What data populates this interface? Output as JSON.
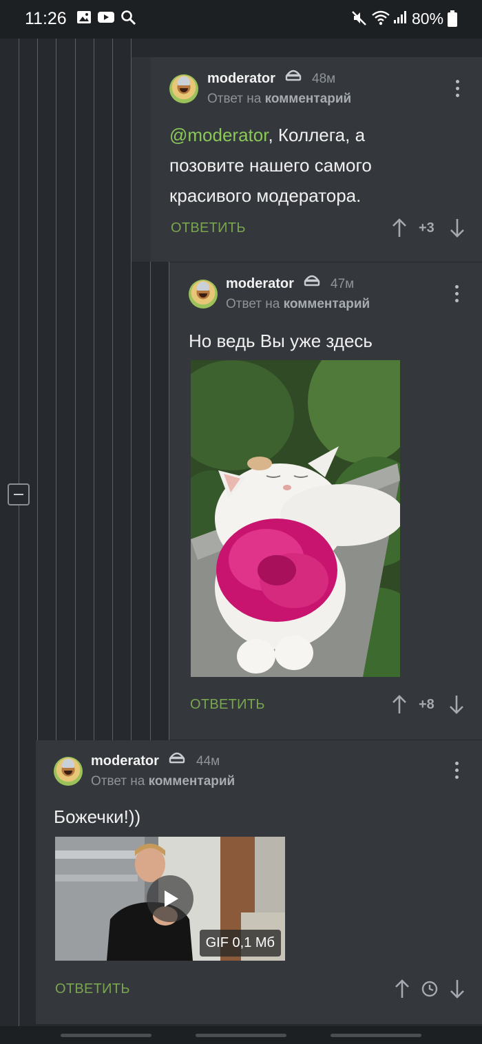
{
  "status_bar": {
    "time": "11:26",
    "battery": "80%",
    "icons": [
      "gallery-icon",
      "youtube-icon",
      "search-icon",
      "mute-icon",
      "wifi-icon",
      "signal-icon",
      "battery-icon"
    ]
  },
  "comments": [
    {
      "username": "moderator",
      "time": "48м",
      "reply_prefix": "Ответ на",
      "reply_target": "комментарий",
      "mention": "@moderator",
      "text": ", Коллега, а позовите нашего самого красивого модератора.",
      "reply_label": "ОТВЕТИТЬ",
      "rating": "+3"
    },
    {
      "username": "moderator",
      "time": "47м",
      "reply_prefix": "Ответ на",
      "reply_target": "комментарий",
      "text": "Но ведь Вы уже здесь",
      "reply_label": "ОТВЕТИТЬ",
      "rating": "+8",
      "image": "cat-with-flower-photo"
    },
    {
      "username": "moderator",
      "time": "44м",
      "reply_prefix": "Ответ на",
      "reply_target": "комментарий",
      "text": "Божечки!))",
      "reply_label": "ОТВЕТИТЬ",
      "gif_label": "GIF 0,1 Мб"
    }
  ],
  "colors": {
    "accent_green": "#7aa64f",
    "mention_green": "#8ac858",
    "card_bg": "#34383c"
  }
}
